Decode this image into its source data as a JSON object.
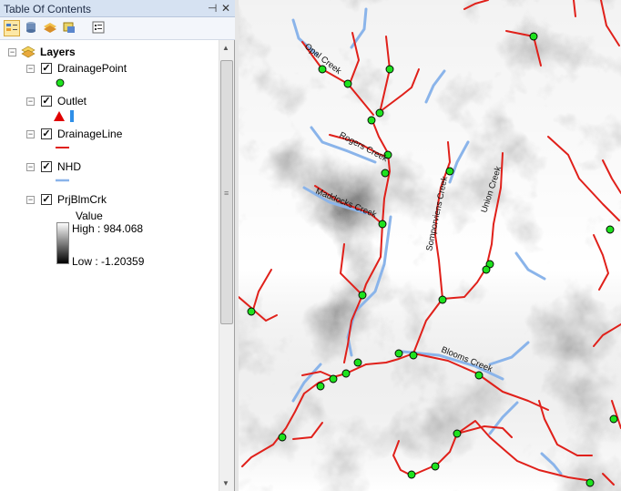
{
  "toc": {
    "title": "Table Of Contents",
    "pin_icon": "pin-icon",
    "close_icon": "close-icon",
    "toolbar": [
      "list-by-drawing-order-icon",
      "list-by-source-icon",
      "list-by-visibility-icon",
      "list-by-selection-icon",
      "options-icon"
    ],
    "root_label": "Layers",
    "layers": [
      {
        "name": "DrainagePoint",
        "checked": true,
        "symbol": "green-dot"
      },
      {
        "name": "Outlet",
        "checked": true,
        "symbol": "red-triangle-blue-bar"
      },
      {
        "name": "DrainageLine",
        "checked": true,
        "symbol": "red-line"
      },
      {
        "name": "NHD",
        "checked": true,
        "symbol": "blue-line"
      },
      {
        "name": "PrjBlmCrk",
        "checked": true,
        "symbol": "raster-ramp",
        "value_label": "Value",
        "high_label": "High : 984.068",
        "low_label": "Low : -1.20359"
      }
    ]
  },
  "map": {
    "labels": {
      "opal": "Opal Creek",
      "rogers": "Rogers Creek",
      "maddocks": "Maddocks Creek",
      "sompenrens": "Somporviens Creek",
      "union": "Union Creek",
      "blooms": "Blooms Creek"
    },
    "colors": {
      "stream": "#e0201a",
      "nhd": "#8ab4ea",
      "point": "#1ee21e"
    }
  }
}
